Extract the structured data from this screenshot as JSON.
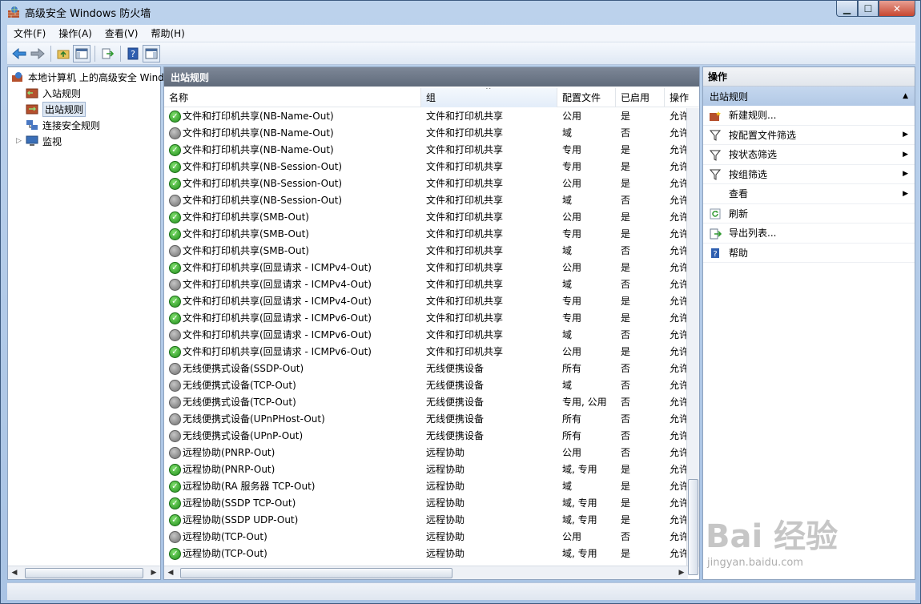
{
  "window": {
    "title": "高级安全 Windows 防火墙",
    "controls": {
      "min": "▁",
      "max": "☐",
      "close": "✕"
    }
  },
  "menu": [
    "文件(F)",
    "操作(A)",
    "查看(V)",
    "帮助(H)"
  ],
  "tree": {
    "root": "本地计算机 上的高级安全 Wind",
    "items": [
      "入站规则",
      "出站规则",
      "连接安全规则",
      "监视"
    ]
  },
  "center": {
    "header": "出站规则",
    "columns": [
      "名称",
      "组",
      "配置文件",
      "已启用",
      "操作"
    ],
    "rows": [
      {
        "name": "文件和打印机共享(NB-Name-Out)",
        "group": "文件和打印机共享",
        "profile": "公用",
        "enabled": "是",
        "action": "允许"
      },
      {
        "name": "文件和打印机共享(NB-Name-Out)",
        "group": "文件和打印机共享",
        "profile": "域",
        "enabled": "否",
        "action": "允许"
      },
      {
        "name": "文件和打印机共享(NB-Name-Out)",
        "group": "文件和打印机共享",
        "profile": "专用",
        "enabled": "是",
        "action": "允许"
      },
      {
        "name": "文件和打印机共享(NB-Session-Out)",
        "group": "文件和打印机共享",
        "profile": "专用",
        "enabled": "是",
        "action": "允许"
      },
      {
        "name": "文件和打印机共享(NB-Session-Out)",
        "group": "文件和打印机共享",
        "profile": "公用",
        "enabled": "是",
        "action": "允许"
      },
      {
        "name": "文件和打印机共享(NB-Session-Out)",
        "group": "文件和打印机共享",
        "profile": "域",
        "enabled": "否",
        "action": "允许"
      },
      {
        "name": "文件和打印机共享(SMB-Out)",
        "group": "文件和打印机共享",
        "profile": "公用",
        "enabled": "是",
        "action": "允许"
      },
      {
        "name": "文件和打印机共享(SMB-Out)",
        "group": "文件和打印机共享",
        "profile": "专用",
        "enabled": "是",
        "action": "允许"
      },
      {
        "name": "文件和打印机共享(SMB-Out)",
        "group": "文件和打印机共享",
        "profile": "域",
        "enabled": "否",
        "action": "允许"
      },
      {
        "name": "文件和打印机共享(回显请求 - ICMPv4-Out)",
        "group": "文件和打印机共享",
        "profile": "公用",
        "enabled": "是",
        "action": "允许"
      },
      {
        "name": "文件和打印机共享(回显请求 - ICMPv4-Out)",
        "group": "文件和打印机共享",
        "profile": "域",
        "enabled": "否",
        "action": "允许"
      },
      {
        "name": "文件和打印机共享(回显请求 - ICMPv4-Out)",
        "group": "文件和打印机共享",
        "profile": "专用",
        "enabled": "是",
        "action": "允许"
      },
      {
        "name": "文件和打印机共享(回显请求 - ICMPv6-Out)",
        "group": "文件和打印机共享",
        "profile": "专用",
        "enabled": "是",
        "action": "允许"
      },
      {
        "name": "文件和打印机共享(回显请求 - ICMPv6-Out)",
        "group": "文件和打印机共享",
        "profile": "域",
        "enabled": "否",
        "action": "允许"
      },
      {
        "name": "文件和打印机共享(回显请求 - ICMPv6-Out)",
        "group": "文件和打印机共享",
        "profile": "公用",
        "enabled": "是",
        "action": "允许"
      },
      {
        "name": "无线便携式设备(SSDP-Out)",
        "group": "无线便携设备",
        "profile": "所有",
        "enabled": "否",
        "action": "允许"
      },
      {
        "name": "无线便携式设备(TCP-Out)",
        "group": "无线便携设备",
        "profile": "域",
        "enabled": "否",
        "action": "允许"
      },
      {
        "name": "无线便携式设备(TCP-Out)",
        "group": "无线便携设备",
        "profile": "专用, 公用",
        "enabled": "否",
        "action": "允许"
      },
      {
        "name": "无线便携式设备(UPnPHost-Out)",
        "group": "无线便携设备",
        "profile": "所有",
        "enabled": "否",
        "action": "允许"
      },
      {
        "name": "无线便携式设备(UPnP-Out)",
        "group": "无线便携设备",
        "profile": "所有",
        "enabled": "否",
        "action": "允许"
      },
      {
        "name": "远程协助(PNRP-Out)",
        "group": "远程协助",
        "profile": "公用",
        "enabled": "否",
        "action": "允许"
      },
      {
        "name": "远程协助(PNRP-Out)",
        "group": "远程协助",
        "profile": "域, 专用",
        "enabled": "是",
        "action": "允许"
      },
      {
        "name": "远程协助(RA 服务器 TCP-Out)",
        "group": "远程协助",
        "profile": "域",
        "enabled": "是",
        "action": "允许"
      },
      {
        "name": "远程协助(SSDP TCP-Out)",
        "group": "远程协助",
        "profile": "域, 专用",
        "enabled": "是",
        "action": "允许"
      },
      {
        "name": "远程协助(SSDP UDP-Out)",
        "group": "远程协助",
        "profile": "域, 专用",
        "enabled": "是",
        "action": "允许"
      },
      {
        "name": "远程协助(TCP-Out)",
        "group": "远程协助",
        "profile": "公用",
        "enabled": "否",
        "action": "允许"
      },
      {
        "name": "远程协助(TCP-Out)",
        "group": "远程协助",
        "profile": "域, 专用",
        "enabled": "是",
        "action": "允许"
      }
    ]
  },
  "actions": {
    "header": "操作",
    "section": "出站规则",
    "items": [
      {
        "label": "新建规则...",
        "icon": "new-rule-icon",
        "submenu": false
      },
      {
        "label": "按配置文件筛选",
        "icon": "filter-icon",
        "submenu": true
      },
      {
        "label": "按状态筛选",
        "icon": "filter-icon",
        "submenu": true
      },
      {
        "label": "按组筛选",
        "icon": "filter-icon",
        "submenu": true
      },
      {
        "label": "查看",
        "icon": "",
        "submenu": true
      },
      {
        "label": "刷新",
        "icon": "refresh-icon",
        "submenu": false
      },
      {
        "label": "导出列表...",
        "icon": "export-icon",
        "submenu": false
      },
      {
        "label": "帮助",
        "icon": "help-icon",
        "submenu": false
      }
    ]
  },
  "watermark": {
    "brand": "Bai 经验",
    "url": "jingyan.baidu.com"
  },
  "colors": {
    "enabled": "#2a9a22",
    "disabled": "#7a7a7a",
    "header": "#6a7484",
    "selection": "#c3d5ee"
  }
}
